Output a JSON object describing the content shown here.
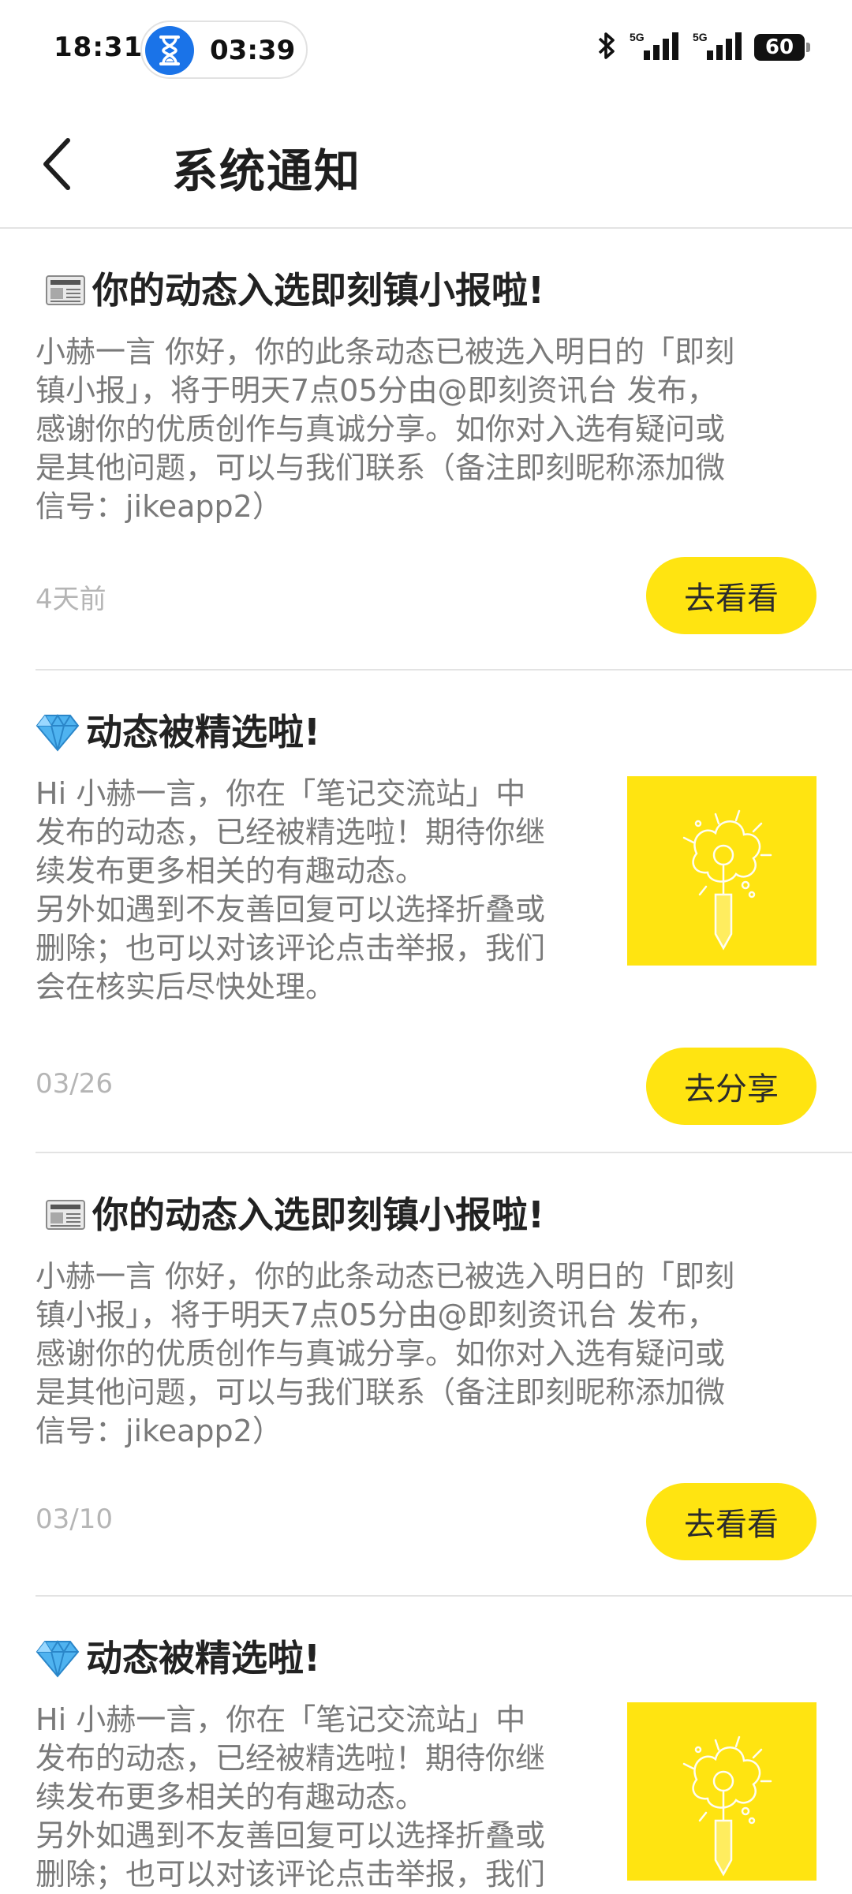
{
  "status_bar": {
    "time": "18:31",
    "timer": "03:39",
    "battery": "60"
  },
  "header": {
    "title": "系统通知"
  },
  "notifications": [
    {
      "title": "你的动态入选即刻镇小报啦!",
      "lines": [
        "小赫一言 你好，你的此条动态已被选入明日的「即刻",
        "镇小报」，将于明天7点05分由@即刻资讯台 发布，",
        "感谢你的优质创作与真诚分享。如你对入选有疑问或",
        "是其他问题，可以与我们联系（备注即刻昵称添加微",
        "信号：jikeapp2）"
      ],
      "time": "4天前",
      "action": "去看看"
    },
    {
      "title": "动态被精选啦!",
      "lines": [
        "Hi 小赫一言，你在「笔记交流站」中",
        "发布的动态，已经被精选啦！期待你继",
        "续发布更多相关的有趣动态。",
        "另外如遇到不友善回复可以选择折叠或",
        "删除；也可以对该评论点击举报，我们",
        "会在核实后尽快处理。"
      ],
      "time": "03/26",
      "action": "去分享"
    },
    {
      "title": "你的动态入选即刻镇小报啦!",
      "lines": [
        "小赫一言 你好，你的此条动态已被选入明日的「即刻",
        "镇小报」，将于明天7点05分由@即刻资讯台 发布，",
        "感谢你的优质创作与真诚分享。如你对入选有疑问或",
        "是其他问题，可以与我们联系（备注即刻昵称添加微",
        "信号：jikeapp2）"
      ],
      "time": "03/10",
      "action": "去看看"
    },
    {
      "title": "动态被精选啦!",
      "lines": [
        "Hi 小赫一言，你在「笔记交流站」中",
        "发布的动态，已经被精选啦！期待你继",
        "续发布更多相关的有趣动态。",
        "另外如遇到不友善回复可以选择折叠或",
        "删除；也可以对该评论点击举报，我们"
      ]
    }
  ]
}
